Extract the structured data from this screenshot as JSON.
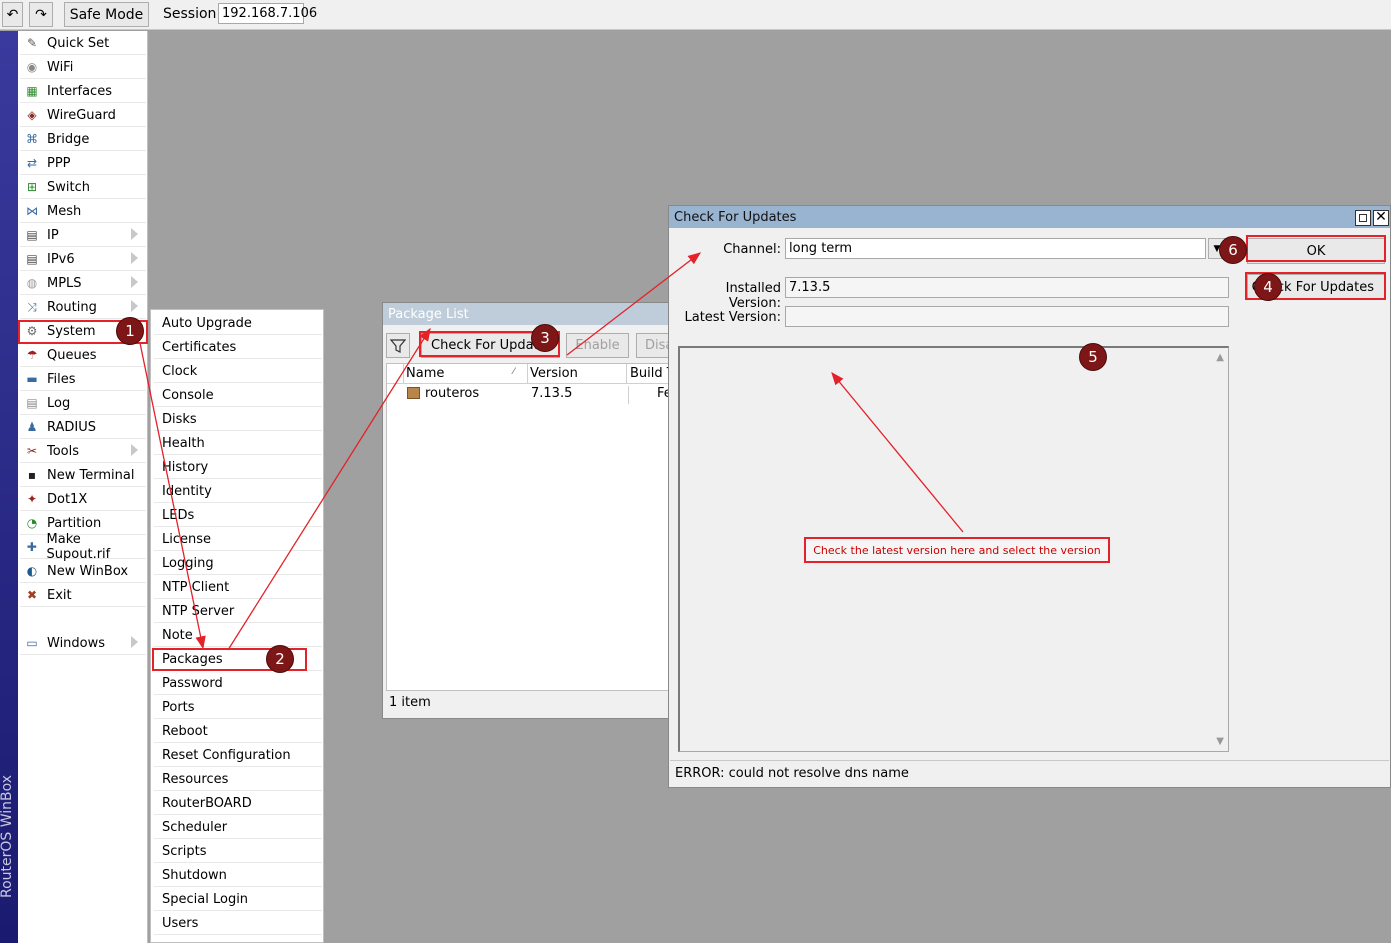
{
  "toolbar": {
    "safe_mode": "Safe Mode",
    "session_label": "Session:",
    "session_value": "192.168.7.106"
  },
  "brand": {
    "vertical_text": "RouterOS WinBox"
  },
  "menu": [
    {
      "label": "Quick Set",
      "icon": "wand-icon",
      "arrow": false
    },
    {
      "label": "WiFi",
      "icon": "wifi-icon",
      "arrow": false
    },
    {
      "label": "Interfaces",
      "icon": "interfaces-icon",
      "arrow": false
    },
    {
      "label": "WireGuard",
      "icon": "wireguard-icon",
      "arrow": false
    },
    {
      "label": "Bridge",
      "icon": "bridge-icon",
      "arrow": false
    },
    {
      "label": "PPP",
      "icon": "ppp-icon",
      "arrow": false
    },
    {
      "label": "Switch",
      "icon": "switch-icon",
      "arrow": false
    },
    {
      "label": "Mesh",
      "icon": "mesh-icon",
      "arrow": false
    },
    {
      "label": "IP",
      "icon": "ip-icon",
      "arrow": true
    },
    {
      "label": "IPv6",
      "icon": "ipv6-icon",
      "arrow": true
    },
    {
      "label": "MPLS",
      "icon": "mpls-icon",
      "arrow": true
    },
    {
      "label": "Routing",
      "icon": "routing-icon",
      "arrow": true
    },
    {
      "label": "System",
      "icon": "gear-icon",
      "arrow": true
    },
    {
      "label": "Queues",
      "icon": "queues-icon",
      "arrow": false
    },
    {
      "label": "Files",
      "icon": "folder-icon",
      "arrow": false
    },
    {
      "label": "Log",
      "icon": "log-icon",
      "arrow": false
    },
    {
      "label": "RADIUS",
      "icon": "radius-icon",
      "arrow": false
    },
    {
      "label": "Tools",
      "icon": "tools-icon",
      "arrow": true
    },
    {
      "label": "New Terminal",
      "icon": "terminal-icon",
      "arrow": false
    },
    {
      "label": "Dot1X",
      "icon": "dot1x-icon",
      "arrow": false
    },
    {
      "label": "Partition",
      "icon": "partition-icon",
      "arrow": false
    },
    {
      "label": "Make Supout.rif",
      "icon": "supout-icon",
      "arrow": false
    },
    {
      "label": "New WinBox",
      "icon": "winbox-icon",
      "arrow": false
    },
    {
      "label": "Exit",
      "icon": "exit-icon",
      "arrow": false
    }
  ],
  "windows_item": {
    "label": "Windows",
    "icon": "windows-icon"
  },
  "submenu": [
    "Auto Upgrade",
    "Certificates",
    "Clock",
    "Console",
    "Disks",
    "Health",
    "History",
    "Identity",
    "LEDs",
    "License",
    "Logging",
    "NTP Client",
    "NTP Server",
    "Note",
    "Packages",
    "Password",
    "Ports",
    "Reboot",
    "Reset Configuration",
    "Resources",
    "RouterBOARD",
    "Scheduler",
    "Scripts",
    "Shutdown",
    "Special Login",
    "Users"
  ],
  "package_list": {
    "title": "Package List",
    "buttons": {
      "check": "Check For Updates",
      "enable": "Enable",
      "disable": "Disa"
    },
    "columns": [
      "Name",
      "Version",
      "Build T"
    ],
    "rows": [
      {
        "name": "routeros",
        "version": "7.13.5",
        "build": "Fe"
      }
    ],
    "status": "1 item"
  },
  "check_updates": {
    "title": "Check For Updates",
    "channel_label": "Channel:",
    "channel_value": "long term",
    "installed_label": "Installed Version:",
    "installed_value": "7.13.5",
    "latest_label": "Latest Version:",
    "latest_value": "",
    "ok": "OK",
    "check_button": "Check For Updates",
    "status": "ERROR: could not resolve dns name"
  },
  "annotations": {
    "badges": [
      "1",
      "2",
      "3",
      "4",
      "5",
      "6"
    ],
    "note": "Check the latest version here and select the version"
  },
  "colors": {
    "annotation": "#e3222a",
    "badge": "#7d1717"
  }
}
